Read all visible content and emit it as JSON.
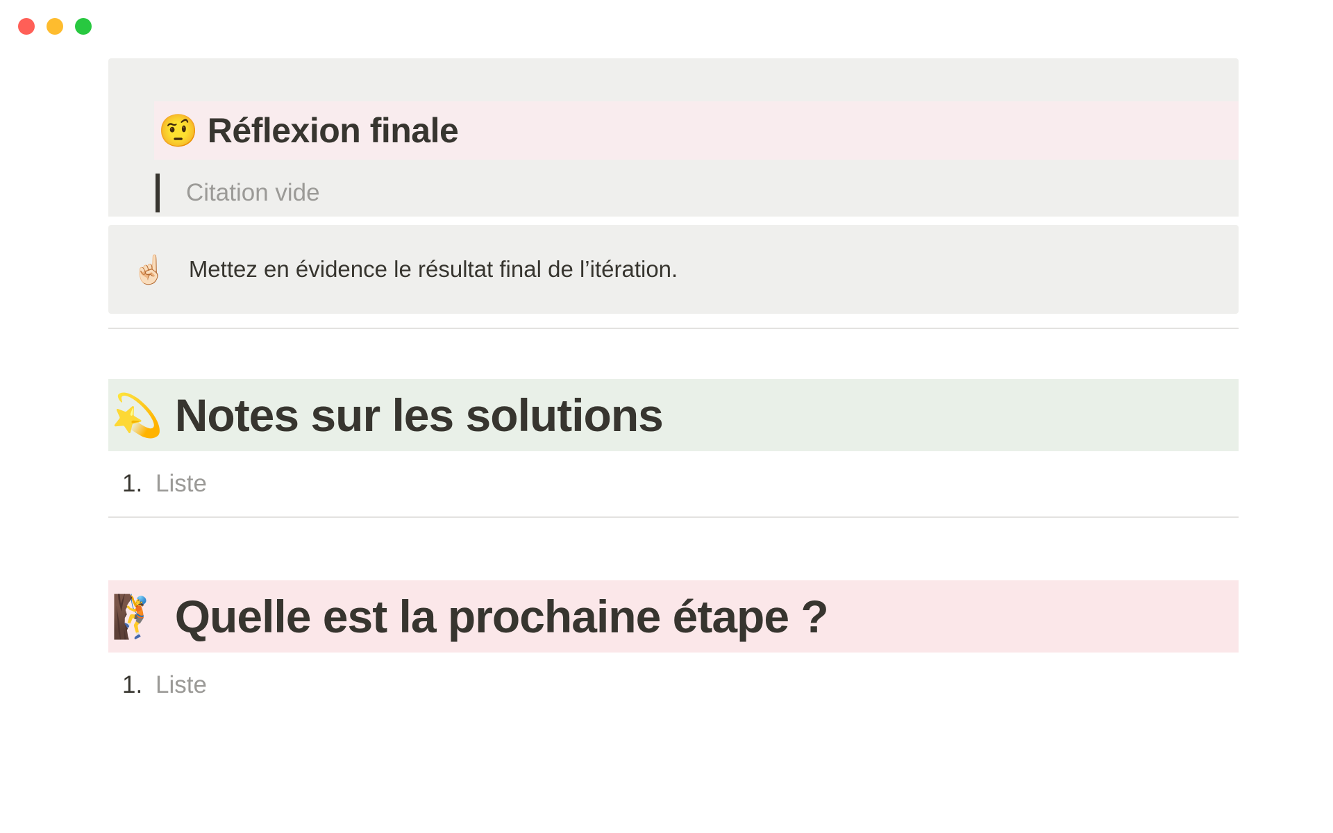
{
  "window": {
    "controls": [
      "close",
      "minimize",
      "maximize"
    ],
    "colors": {
      "close": "#ff5f57",
      "minimize": "#febc2e",
      "maximize": "#28c840"
    }
  },
  "reflection": {
    "emoji": "🤨",
    "emoji_name": "face-with-raised-eyebrow",
    "title": "Réflexion finale",
    "quote_placeholder": "Citation vide"
  },
  "callout": {
    "emoji": "☝🏻",
    "emoji_name": "index-pointing-up",
    "text": "Mettez en évidence le résultat final de l’itération."
  },
  "sections": [
    {
      "emoji": "💫",
      "emoji_name": "dizzy",
      "title": "Notes sur les solutions",
      "color": "#e9f0e8",
      "list": [
        {
          "number": "1.",
          "placeholder": "Liste"
        }
      ]
    },
    {
      "emoji": "🧗",
      "emoji_name": "person-climbing",
      "title": "Quelle est la prochaine étape ?",
      "color": "#fbe7e9",
      "list": [
        {
          "number": "1.",
          "placeholder": "Liste"
        }
      ]
    }
  ]
}
